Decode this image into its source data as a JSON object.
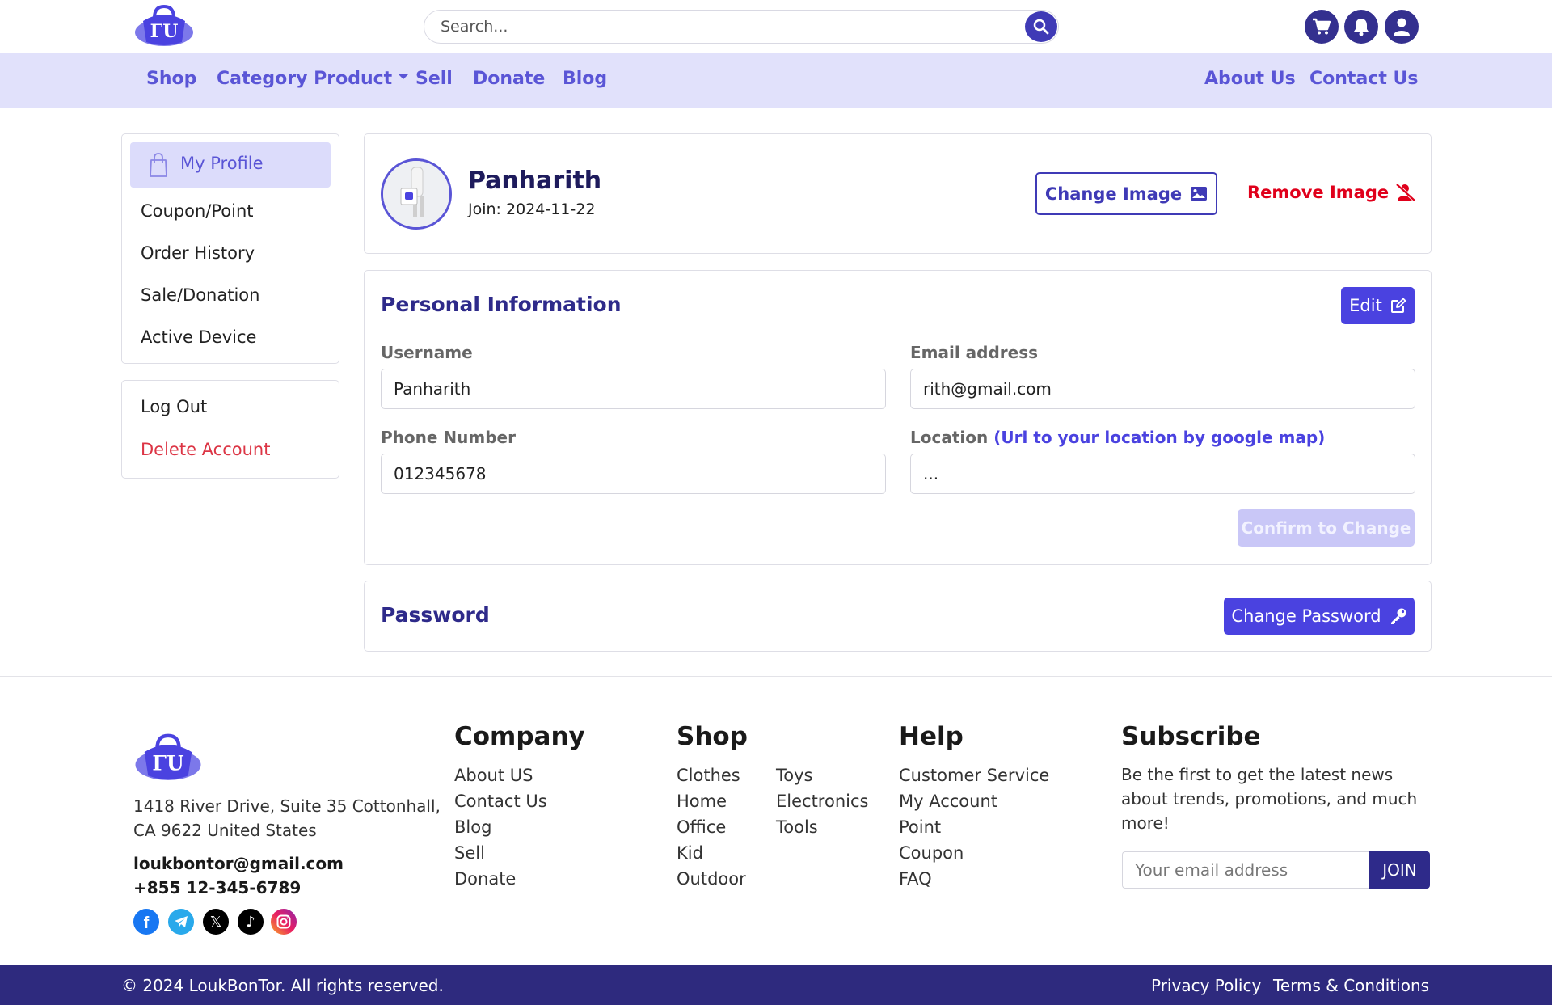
{
  "header": {
    "search_placeholder": "Search...",
    "icons": [
      "cart-icon",
      "bell-icon",
      "user-icon"
    ]
  },
  "nav": {
    "shop": "Shop",
    "category": "Category Product",
    "sell": "Sell",
    "donate": "Donate",
    "blog": "Blog",
    "about": "About Us",
    "contact": "Contact Us"
  },
  "sidebar": {
    "items": [
      "My Profile",
      "Coupon/Point",
      "Order History",
      "Sale/Donation",
      "Active Device"
    ],
    "logout": "Log Out",
    "delete": "Delete Account"
  },
  "profile": {
    "name": "Panharith",
    "join": "Join: 2024-11-22",
    "change_image": "Change Image",
    "remove_image": "Remove Image"
  },
  "personal": {
    "title": "Personal Information",
    "edit": "Edit",
    "username_label": "Username",
    "username_value": "Panharith",
    "email_label": "Email address",
    "email_value": "rith@gmail.com",
    "phone_label": "Phone Number",
    "phone_value": "012345678",
    "location_label": "Location",
    "location_hint": "(Url to your location by google map)",
    "location_value": "...",
    "confirm": "Confirm to Change"
  },
  "password": {
    "title": "Password",
    "change": "Change Password"
  },
  "footer": {
    "address_line1": "1418 River Drive, Suite 35 Cottonhall,",
    "address_line2": "CA 9622 United States",
    "email": "loukbontor@gmail.com",
    "phone": "+855 12-345-6789",
    "company": {
      "title": "Company",
      "links": [
        "About US",
        "Contact Us",
        "Blog",
        "Sell",
        "Donate"
      ]
    },
    "shop": {
      "title": "Shop",
      "col1": [
        "Clothes",
        "Home",
        "Office",
        "Kid",
        "Outdoor"
      ],
      "col2": [
        "Toys",
        "Electronics",
        "Tools"
      ]
    },
    "help": {
      "title": "Help",
      "links": [
        "Customer Service",
        "My Account",
        "Point",
        "Coupon",
        "FAQ"
      ]
    },
    "subscribe": {
      "title": "Subscribe",
      "text1": "Be the first to get the latest news",
      "text2": "about trends, promotions, and much",
      "text3": "more!",
      "placeholder": "Your email address",
      "join": "JOIN"
    },
    "social": [
      "facebook-icon",
      "telegram-icon",
      "x-icon",
      "tiktok-icon",
      "instagram-icon"
    ],
    "copyright": "© 2024 LoukBonTor. All rights reserved.",
    "privacy": "Privacy Policy",
    "terms": "Terms & Conditions"
  },
  "colors": {
    "primary": "#4a42e0",
    "dark": "#2e2a8a",
    "nav_bg": "#e1e1fb",
    "danger": "#e0001b"
  }
}
